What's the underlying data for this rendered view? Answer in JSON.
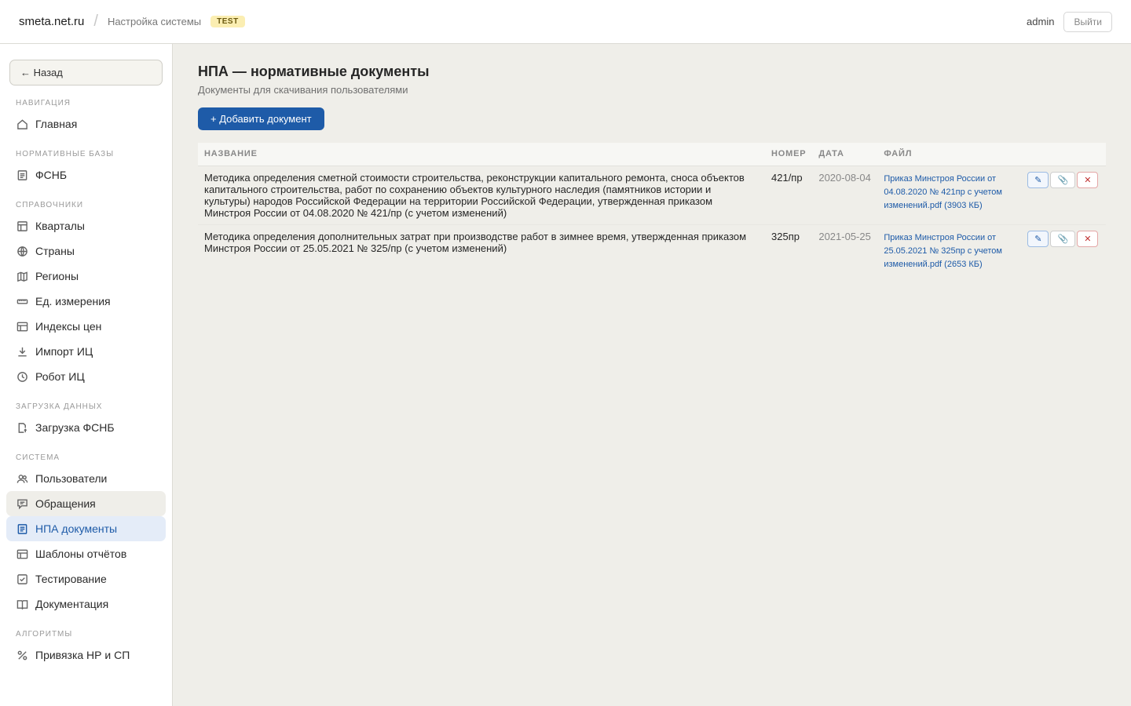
{
  "header": {
    "brand": "smeta.net.ru",
    "separator": "/",
    "breadcrumb": "Настройка системы",
    "env_badge": "TEST",
    "user": "admin",
    "logout_label": "Выйти"
  },
  "sidebar": {
    "back_label": "← Назад",
    "sections": {
      "nav": "НАВИГАЦИЯ",
      "norm": "НОРМАТИВНЫЕ БАЗЫ",
      "refs": "СПРАВОЧНИКИ",
      "load": "ЗАГРУЗКА ДАННЫХ",
      "system": "СИСТЕМА",
      "algo": "АЛГОРИТМЫ"
    },
    "items": {
      "home": "Главная",
      "fsnb": "ФСНБ",
      "quarters": "Кварталы",
      "countries": "Страны",
      "regions": "Регионы",
      "units": "Ед. измерения",
      "price_indexes": "Индексы цен",
      "import_ic": "Импорт ИЦ",
      "robot_ic": "Робот ИЦ",
      "load_fsnb": "Загрузка ФСНБ",
      "users": "Пользователи",
      "requests": "Обращения",
      "npa_docs": "НПА документы",
      "report_templates": "Шаблоны отчётов",
      "testing": "Тестирование",
      "documentation": "Документация",
      "binding": "Привязка НР и СП"
    }
  },
  "main": {
    "title": "НПА — нормативные документы",
    "subtitle": "Документы для скачивания пользователями",
    "add_label": "+ Добавить документ",
    "columns": {
      "name": "НАЗВАНИЕ",
      "number": "НОМЕР",
      "date": "ДАТА",
      "file": "ФАЙЛ"
    },
    "rows": [
      {
        "name": "Методика определения сметной стоимости строительства, реконструкции капитального ремонта, сноса объектов капитального строительства, работ по сохранению объектов культурного наследия (памятников истории и культуры) народов Российской Федерации на территории Российской Федерации, утвержденная приказом Минстроя России от 04.08.2020 № 421/пр (с учетом изменений)",
        "number": "421/пр",
        "date": "2020-08-04",
        "file": "Приказ Минстроя России от 04.08.2020 № 421пр с учетом изменений.pdf (3903 КБ)"
      },
      {
        "name": "Методика определения дополнительных затрат при производстве работ в зимнее время, утвержденная приказом Минстроя России от 25.05.2021 № 325/пр (с учетом изменений)",
        "number": "325пр",
        "date": "2021-05-25",
        "file": "Приказ Минстроя России от 25.05.2021 № 325пр с учетом изменений.pdf (2653 КБ)"
      }
    ],
    "actions": {
      "edit": "✎",
      "attach": "📎",
      "delete": "✕"
    }
  },
  "colors": {
    "accent": "#1e5ba8",
    "badge_bg": "#fbeeb2",
    "active_bg": "#e4ecf8",
    "danger": "#c03030"
  }
}
